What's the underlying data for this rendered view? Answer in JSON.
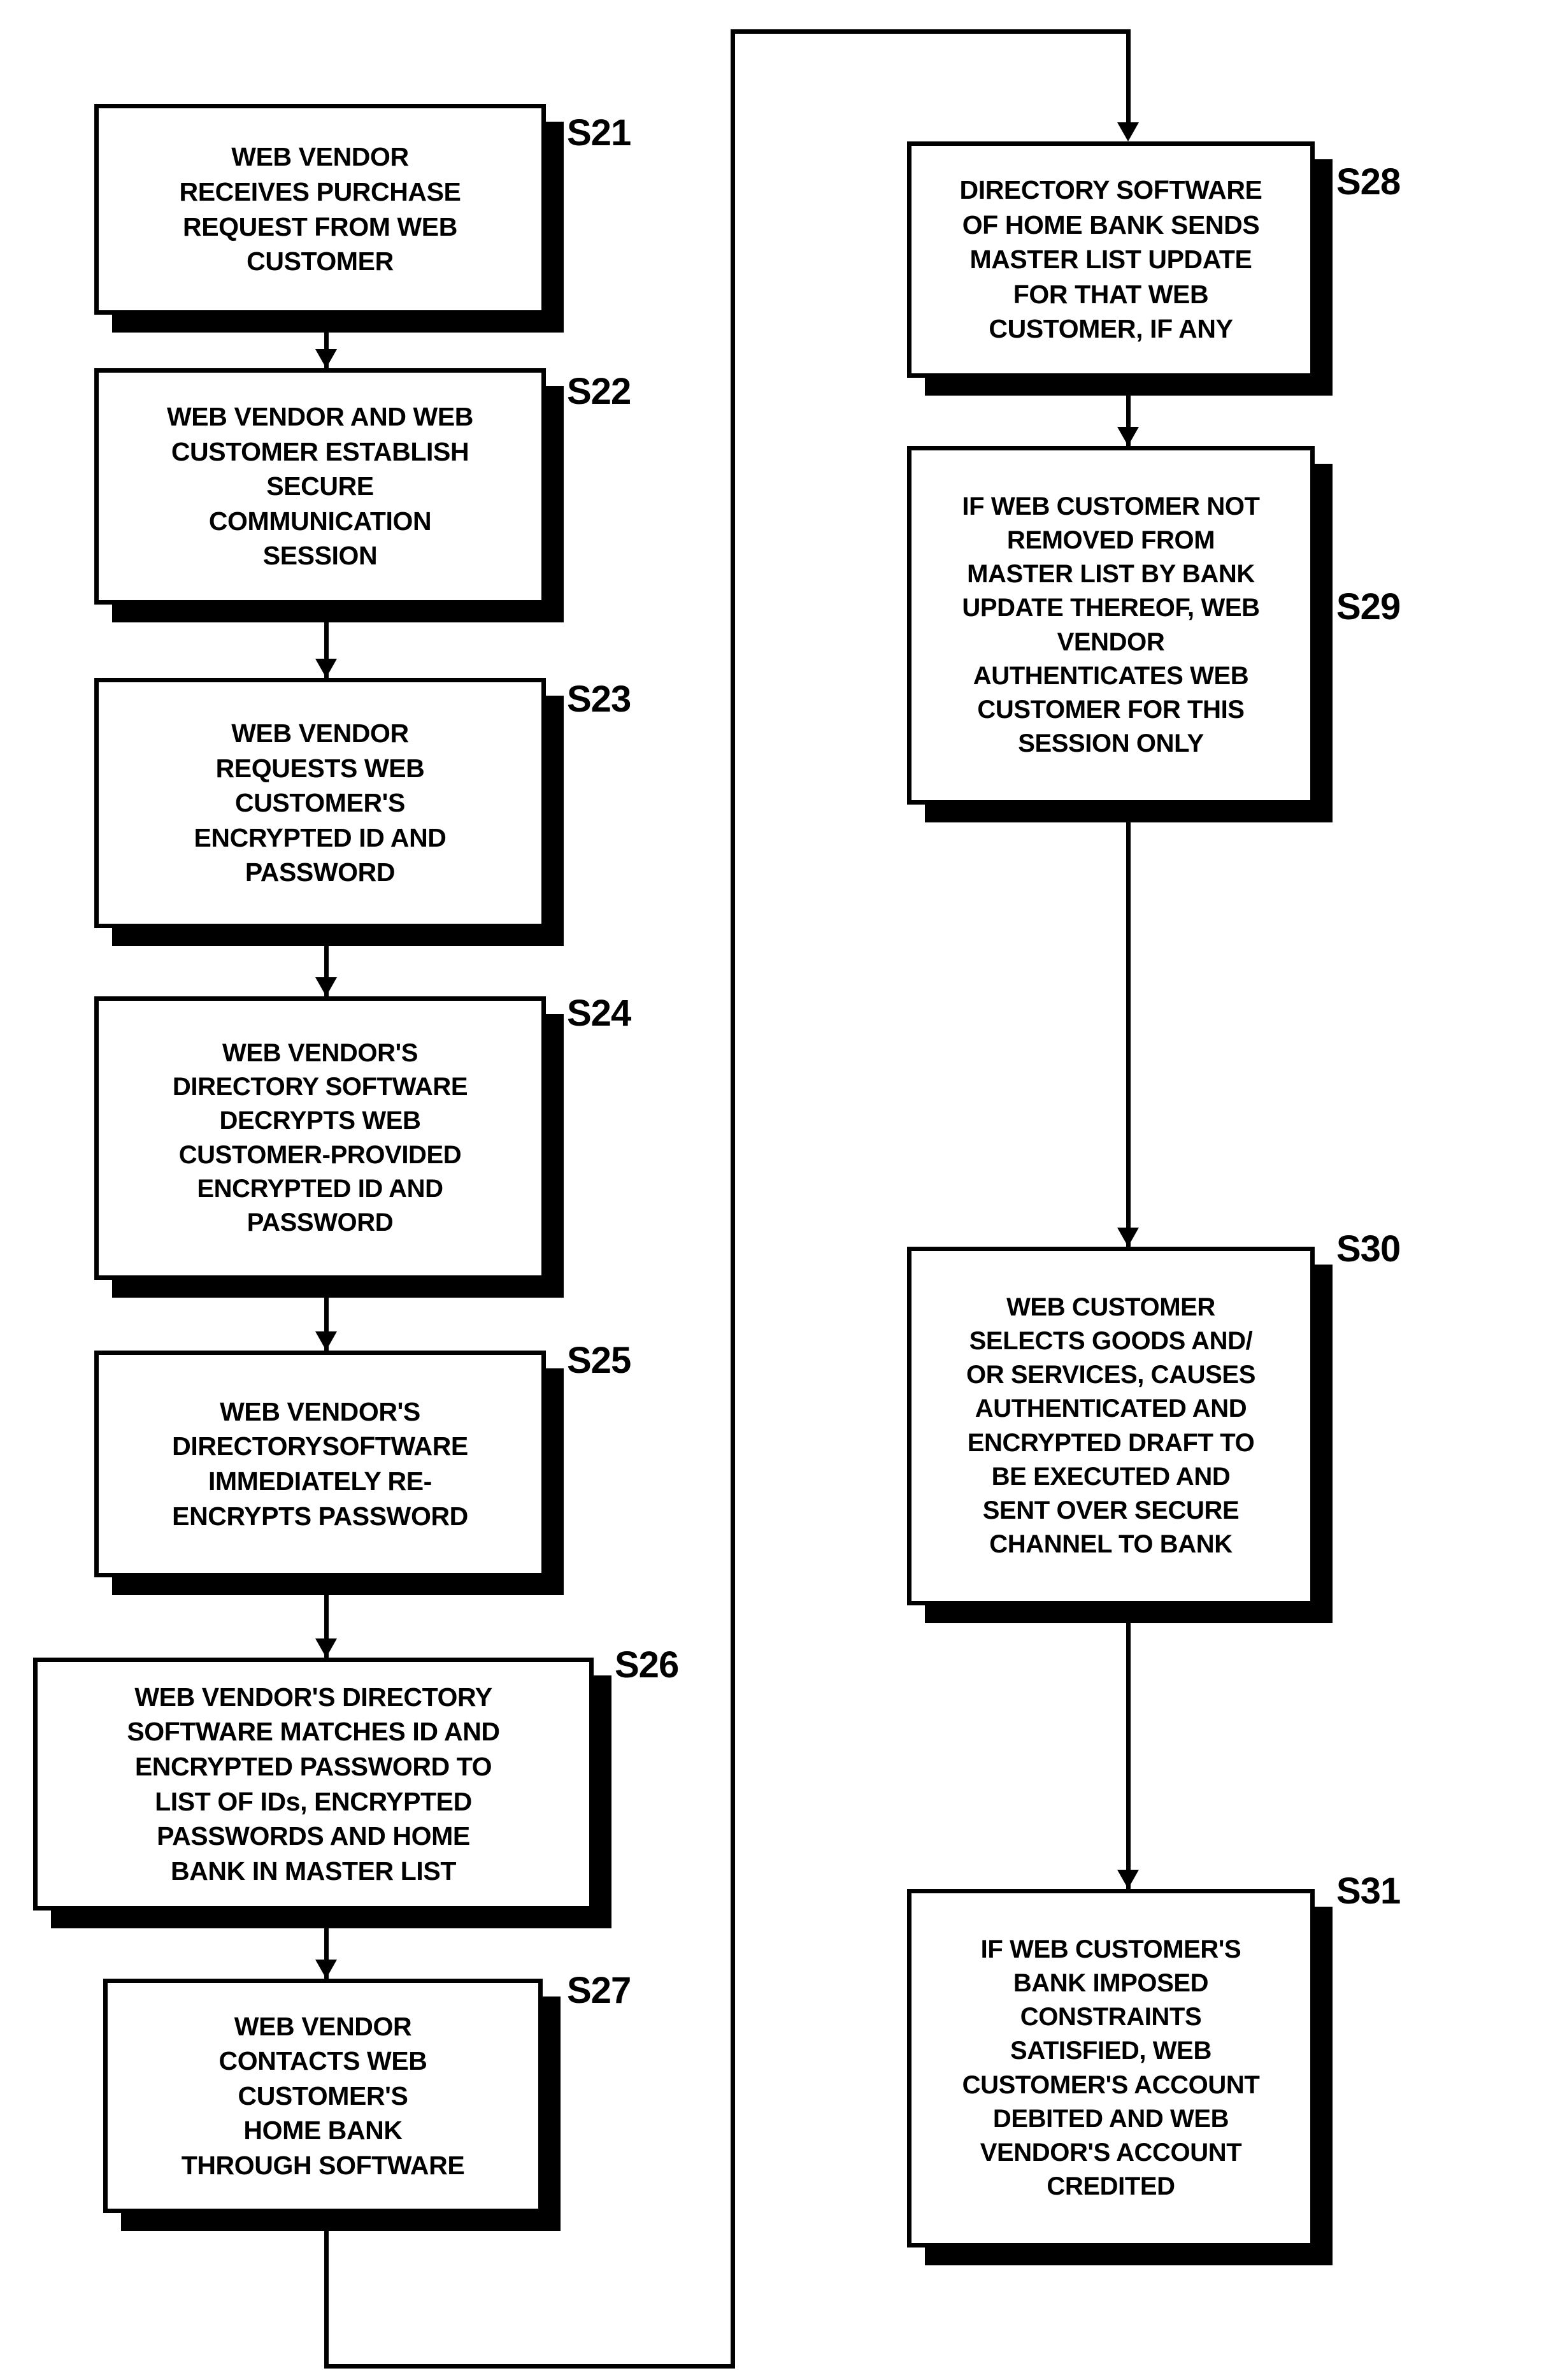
{
  "diagram": {
    "title": "Web vendor purchase authentication flowchart",
    "ink_color": "#000000",
    "paper_color": "#ffffff",
    "nodes": [
      {
        "id": "S21",
        "label": "S21",
        "text": "WEB VENDOR\nRECEIVES PURCHASE\nREQUEST FROM WEB\nCUSTOMER"
      },
      {
        "id": "S22",
        "label": "S22",
        "text": "WEB VENDOR AND WEB\nCUSTOMER ESTABLISH\nSECURE\nCOMMUNICATION\nSESSION"
      },
      {
        "id": "S23",
        "label": "S23",
        "text": "WEB VENDOR\nREQUESTS WEB\nCUSTOMER'S\nENCRYPTED ID AND\nPASSWORD"
      },
      {
        "id": "S24",
        "label": "S24",
        "text": "WEB VENDOR'S\nDIRECTORY SOFTWARE\nDECRYPTS WEB\nCUSTOMER-PROVIDED\nENCRYPTED ID AND\nPASSWORD"
      },
      {
        "id": "S25",
        "label": "S25",
        "text": "WEB VENDOR'S\nDIRECTORYSOFTWARE\nIMMEDIATELY RE-\nENCRYPTS  PASSWORD"
      },
      {
        "id": "S26",
        "label": "S26",
        "text": "WEB VENDOR'S DIRECTORY\nSOFTWARE  MATCHES ID AND\nENCRYPTED  PASSWORD TO\nLIST OF IDs, ENCRYPTED\nPASSWORDS  AND HOME\nBANK IN MASTER LIST"
      },
      {
        "id": "S27",
        "label": "S27",
        "text": "WEB VENDOR\nCONTACTS WEB\nCUSTOMER'S\nHOME BANK\nTHROUGH SOFTWARE"
      },
      {
        "id": "S28",
        "label": "S28",
        "text": "DIRECTORY SOFTWARE\nOF HOME BANK SENDS\nMASTER LIST UPDATE\nFOR THAT WEB\nCUSTOMER, IF ANY"
      },
      {
        "id": "S29",
        "label": "S29",
        "text": "IF WEB CUSTOMER NOT\nREMOVED FROM\nMASTER LIST BY BANK\nUPDATE THEREOF, WEB\nVENDOR\nAUTHENTICATES WEB\nCUSTOMER FOR THIS\nSESSION ONLY"
      },
      {
        "id": "S30",
        "label": "S30",
        "text": "WEB CUSTOMER\nSELECTS GOODS AND/\nOR SERVICES, CAUSES\nAUTHENTICATED AND\nENCRYPTED DRAFT TO\nBE EXECUTED AND\nSENT OVER SECURE\nCHANNEL TO BANK"
      },
      {
        "id": "S31",
        "label": "S31",
        "text": "IF WEB CUSTOMER'S\nBANK IMPOSED\nCONSTRAINTS\nSATISFIED, WEB\nCUSTOMER'S ACCOUNT\nDEBITED AND WEB\nVENDOR'S ACCOUNT\nCREDITED"
      }
    ],
    "edges": [
      {
        "from": "S21",
        "to": "S22",
        "kind": "straight-down"
      },
      {
        "from": "S22",
        "to": "S23",
        "kind": "straight-down"
      },
      {
        "from": "S23",
        "to": "S24",
        "kind": "straight-down"
      },
      {
        "from": "S24",
        "to": "S25",
        "kind": "straight-down"
      },
      {
        "from": "S25",
        "to": "S26",
        "kind": "straight-down"
      },
      {
        "from": "S26",
        "to": "S27",
        "kind": "straight-down"
      },
      {
        "from": "S27",
        "to": "S28",
        "kind": "routed-around-bottom-right-top"
      },
      {
        "from": "S28",
        "to": "S29",
        "kind": "straight-down"
      },
      {
        "from": "S29",
        "to": "S30",
        "kind": "straight-down"
      },
      {
        "from": "S30",
        "to": "S31",
        "kind": "straight-down"
      }
    ]
  }
}
